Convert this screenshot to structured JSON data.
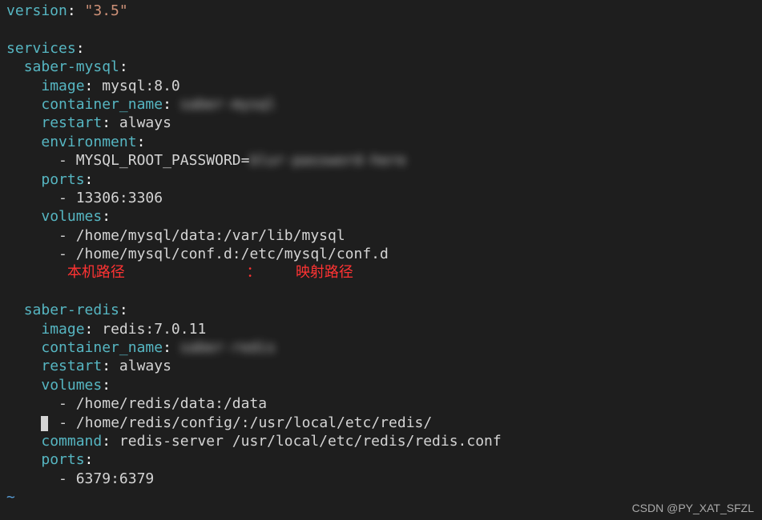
{
  "yaml": {
    "version_key": "version",
    "version_value": "\"3.5\"",
    "services_key": "services",
    "mysql": {
      "name": "saber-mysql",
      "image_key": "image",
      "image_value": "mysql:8.0",
      "container_name_key": "container_name",
      "container_name_value": "saber-mysql",
      "restart_key": "restart",
      "restart_value": "always",
      "environment_key": "environment",
      "env_var": "MYSQL_ROOT_PASSWORD=",
      "env_var_value": "blur-password-here",
      "ports_key": "ports",
      "port1": "13306:3306",
      "volumes_key": "volumes",
      "vol1": "/home/mysql/data:/var/lib/mysql",
      "vol2": "/home/mysql/conf.d:/etc/mysql/conf.d"
    },
    "annotation": {
      "local_path": "本机路径",
      "colon": "：",
      "mapped_path": "映射路径"
    },
    "redis": {
      "name": "saber-redis",
      "image_key": "image",
      "image_value": "redis:7.0.11",
      "container_name_key": "container_name",
      "container_name_value": "saber-redis",
      "restart_key": "restart",
      "restart_value": "always",
      "volumes_key": "volumes",
      "vol1": "/home/redis/data:/data",
      "vol2": "/home/redis/config/:/usr/local/etc/redis/",
      "command_key": "command",
      "command_value": "redis-server /usr/local/etc/redis/redis.conf",
      "ports_key": "ports",
      "port1": "6379:6379"
    },
    "tilde": "~"
  },
  "watermark": "CSDN @PY_XAT_SFZL"
}
